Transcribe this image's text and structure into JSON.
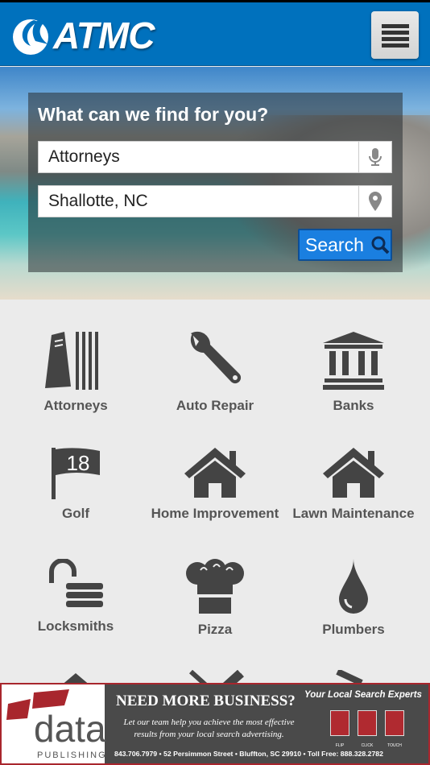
{
  "header": {
    "logo_text": "ATMC",
    "menu_icon": "list-icon",
    "brand_color": "#0071bd"
  },
  "search": {
    "title": "What can we find for you?",
    "what_value": "Attorneys",
    "where_value": "Shallotte, NC",
    "button_label": "Search"
  },
  "categories": [
    {
      "label": "Attorneys",
      "icon": "books-icon"
    },
    {
      "label": "Auto Repair",
      "icon": "wrench-icon"
    },
    {
      "label": "Banks",
      "icon": "bank-icon"
    },
    {
      "label": "Golf",
      "icon": "golf-flag-icon"
    },
    {
      "label": "Home Improvement",
      "icon": "house-icon"
    },
    {
      "label": "Lawn Maintenance",
      "icon": "house-icon"
    },
    {
      "label": "Locksmiths",
      "icon": "unlocked-padlock-icon"
    },
    {
      "label": "Pizza",
      "icon": "chef-hat-icon"
    },
    {
      "label": "Plumbers",
      "icon": "water-drop-icon"
    }
  ],
  "golf_flag_number": "18",
  "ad": {
    "brand": "data",
    "brand_sub": "PUBLISHING",
    "headline": "NEED MORE BUSINESS?",
    "sub_line1": "Let our team help you achieve the most effective",
    "sub_line2": "results from your local search advertising.",
    "tagline": "Your Local Search Experts",
    "icons": [
      "FLIP",
      "CLICK",
      "TOUCH"
    ],
    "footer": "843.706.7979 • 52 Persimmon Street • Bluffton, SC 29910 • Toll Free: 888.328.2782"
  }
}
